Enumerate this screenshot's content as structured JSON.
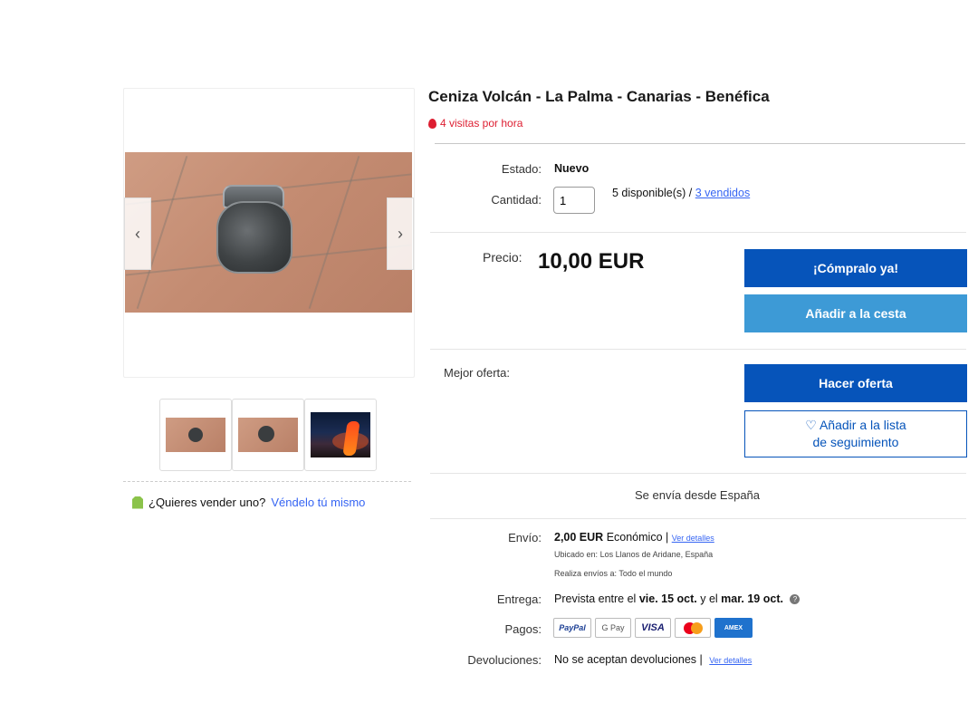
{
  "listing": {
    "title": "Ceniza Volcán - La Palma - Canarias - Benéfica",
    "visits": "4 visitas por hora"
  },
  "gallery": {
    "prev_icon": "chevron-left-icon",
    "next_icon": "chevron-right-icon",
    "prev_glyph": "‹",
    "next_glyph": "›",
    "thumbnails": [
      "jar-photo-1",
      "jar-photo-2",
      "volcano-eruption-photo"
    ]
  },
  "sell": {
    "question": "¿Quieres vender uno?",
    "link": "Véndelo tú mismo"
  },
  "details": {
    "condition_label": "Estado:",
    "condition_value": "Nuevo",
    "quantity_label": "Cantidad:",
    "quantity_value": "1",
    "available_text": "5 disponible(s) /",
    "sold_link": "3 vendidos"
  },
  "price": {
    "label": "Precio:",
    "value": "10,00 EUR",
    "buy_now": "¡Cómpralo ya!",
    "add_to_cart": "Añadir a la cesta"
  },
  "offer": {
    "label": "Mejor oferta:",
    "make_offer": "Hacer oferta",
    "watchlist_line1": "♡ Añadir a la lista",
    "watchlist_line2": "de seguimiento"
  },
  "shipping": {
    "ships_from": "Se envía desde España",
    "shipping_label": "Envío:",
    "shipping_cost": "2,00 EUR",
    "shipping_type": "Económico |",
    "shipping_details_link": "Ver detalles",
    "location_label": "Ubicado en:",
    "location_value": "Los Llanos de Aridane, España",
    "ships_to_label": "Realiza envíos a:",
    "ships_to_value": "Todo el mundo",
    "delivery_label": "Entrega:",
    "delivery_prefix": "Prevista entre el",
    "delivery_start": "vie. 15 oct.",
    "delivery_mid": "y el",
    "delivery_end": "mar. 19 oct.",
    "payments_label": "Pagos:",
    "payment_methods": [
      "PayPal",
      "G Pay",
      "VISA",
      "Mastercard",
      "American Express"
    ],
    "returns_label": "Devoluciones:",
    "returns_value": "No se aceptan devoluciones |",
    "returns_details_link": "Ver detalles"
  },
  "colors": {
    "primary": "#0654ba",
    "secondary": "#3d9ad6",
    "link": "#3665f3",
    "urgency": "#dd1e31"
  }
}
